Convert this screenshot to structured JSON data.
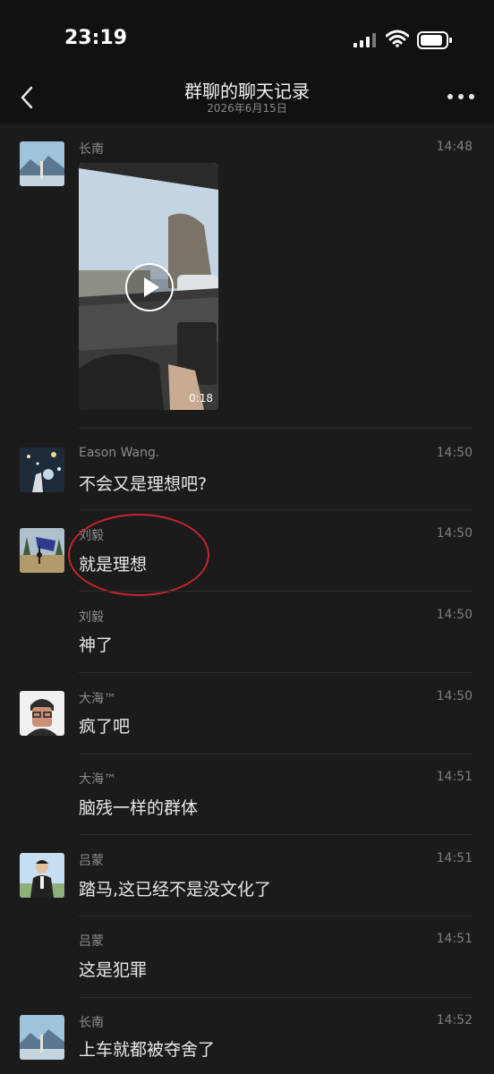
{
  "status_bar": {
    "time": "23:19",
    "signal_icon": "cellular-signal-icon",
    "wifi_icon": "wifi-icon",
    "battery_icon": "battery-icon"
  },
  "nav": {
    "title": "群聊的聊天记录",
    "subtitle": "2026年6月15日",
    "back_icon": "chevron-left-icon",
    "more_icon": "more-dots-icon"
  },
  "video": {
    "duration": "0:18",
    "play_icon": "play-icon"
  },
  "messages": [
    {
      "sender": "长南",
      "time": "14:48",
      "text": ""
    },
    {
      "sender": "Eason Wang.",
      "time": "14:50",
      "text": "不会又是理想吧?"
    },
    {
      "sender": "刘毅",
      "time": "14:50",
      "text": "就是理想"
    },
    {
      "sender": "刘毅",
      "time": "14:50",
      "text": "神了"
    },
    {
      "sender": "大海™",
      "time": "14:50",
      "text": "疯了吧"
    },
    {
      "sender": "大海™",
      "time": "14:51",
      "text": "脑残一样的群体"
    },
    {
      "sender": "吕蒙",
      "time": "14:51",
      "text": "踏马,这已经不是没文化了"
    },
    {
      "sender": "吕蒙",
      "time": "14:51",
      "text": "这是犯罪"
    },
    {
      "sender": "长南",
      "time": "14:52",
      "text": "上车就都被夺舍了"
    }
  ],
  "colors": {
    "background": "#1b1b1b",
    "header": "#111111",
    "annotation": "#c8242b"
  }
}
